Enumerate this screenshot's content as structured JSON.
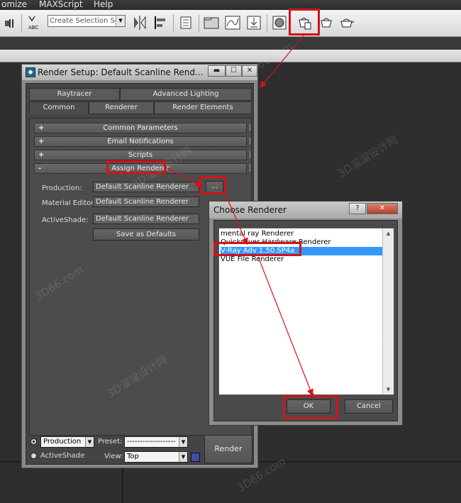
{
  "menubar": {
    "items": [
      "omize",
      "MAXScript",
      "Help"
    ]
  },
  "toolbar": {
    "selection_set": "Create Selection Se",
    "abc_icon_label": "ABC"
  },
  "render_setup": {
    "title": "Render Setup: Default Scanline Rend...",
    "tabs_row1": [
      "Raytracer",
      "Advanced Lighting"
    ],
    "tabs_row2": [
      "Common",
      "Renderer",
      "Render Elements"
    ],
    "rollouts": [
      {
        "sign": "+",
        "label": "Common Parameters"
      },
      {
        "sign": "+",
        "label": "Email Notifications"
      },
      {
        "sign": "+",
        "label": "Scripts"
      },
      {
        "sign": "-",
        "label": "Assign Renderer"
      }
    ],
    "assign": {
      "production_label": "Production:",
      "production_value": "Default Scanline Renderer",
      "material_editor_label": "Material Editor:",
      "material_editor_value": "Default Scanline Renderer",
      "activeshade_label": "ActiveShade:",
      "activeshade_value": "Default Scanline Renderer",
      "browse_button": "...",
      "save_defaults": "Save as Defaults"
    },
    "bottom": {
      "mode_production": "Production",
      "mode_activeshade": "ActiveShade",
      "preset_label": "Preset:",
      "preset_value": "-------------------",
      "view_label": "View:",
      "view_value": "Top",
      "render_button": "Render"
    }
  },
  "choose_renderer": {
    "title": "Choose Renderer",
    "help_button": "?",
    "close_button": "✕",
    "items": [
      "mental ray Renderer",
      "Quicksilver Hardware Renderer",
      "V-Ray Adv 1.50.SP4a",
      "VUE File Renderer"
    ],
    "selected_index": 2,
    "ok": "OK",
    "cancel": "Cancel"
  },
  "watermarks": [
    "3D66.com",
    "3D溜溜设计网",
    "3D66.com",
    "3D溜溜设计网",
    "3D66.com",
    "3D溜溜设计网",
    "3D66.com"
  ],
  "colors": {
    "highlight": "#d01418",
    "selection": "#3399ff"
  }
}
